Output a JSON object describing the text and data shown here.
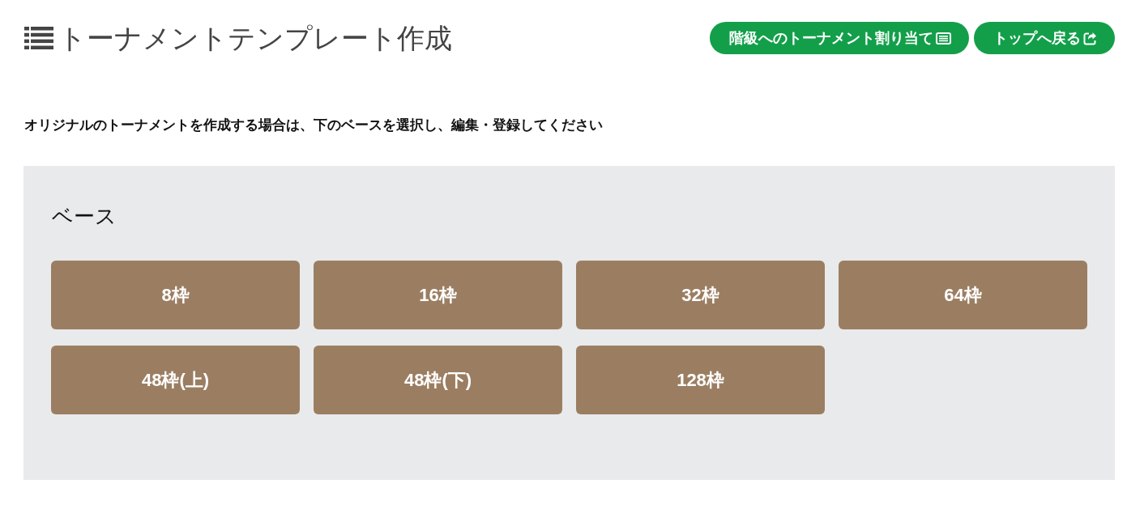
{
  "title": "トーナメントテンプレート作成",
  "header_buttons": [
    {
      "label": "階級へのトーナメント割り当て"
    },
    {
      "label": "トップへ戻る"
    }
  ],
  "description": "オリジナルのトーナメントを作成する場合は、下のベースを選択し、編集・登録してください",
  "base_panel": {
    "heading": "ベース",
    "options": [
      "8枠",
      "16枠",
      "32枠",
      "64枠",
      "48枠(上)",
      "48枠(下)",
      "128枠"
    ]
  }
}
